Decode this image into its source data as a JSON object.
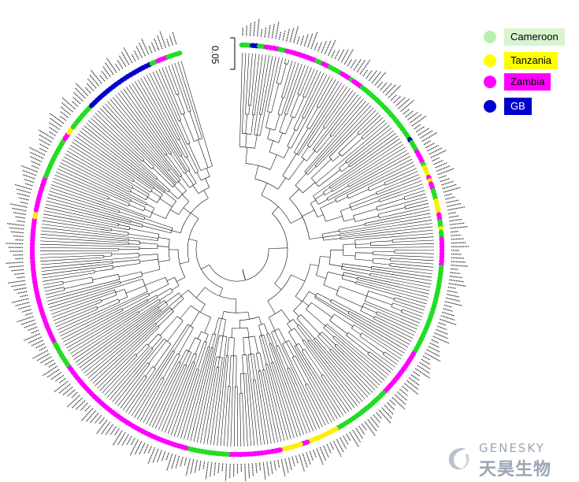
{
  "scale_bar": {
    "label": "0.05"
  },
  "legend": [
    {
      "label": "Cameroon",
      "color": "#55e055",
      "bg": "#d8f5d0"
    },
    {
      "label": "Tanzania",
      "color": "#ffff00",
      "bg": "#ffff00"
    },
    {
      "label": "Zambia",
      "color": "#ff00ff",
      "bg": "#ff00ff"
    },
    {
      "label": "GB",
      "color": "#0000cc",
      "bg": "#0000cc",
      "text_color": "#ffffff"
    }
  ],
  "watermark": {
    "english": "GENESKY",
    "chinese": "天昊生物"
  },
  "tips": "GGGBBGGMMMMGGMMMMMMMMMGGMMGGGGMMMGMMMGGGGGGGGGGGGGGGGGGGGBGGGMMMMGYYYMYMMGGGYYYYMMGGYGGMMMMMMMMGGGGGGGGGGGGGGGGGGGGGGGGGGMMMMMMMMMMMMMMGGGGGGGGGGGGGGGGGYYYYYYYYYMMYYYYYYMMMMMMMMMMMMMMMGGGGGGGGGGGGMMMMMMMMMMMMMMMMMMMMMMMMMMMMMMMMMMMMMMMMMMGGGGGGGGMMMMMMMMMMMMMMMMMMMMMMMMMMMMMMMMMMMMYYMMMMMMMMMMGGGGGGGGGGGGMMYYGGGGGGGGBBBBBBBBBBBBBBBBBBBBBGGMMMGGGG"
}
